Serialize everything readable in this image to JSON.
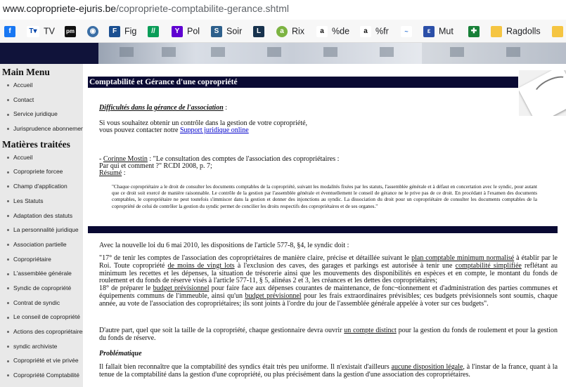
{
  "browser": {
    "url_domain": "www.copropriete-ejuris.be",
    "url_path": "/copropriete-comptabilite-gerance.shtml",
    "bookmarks": [
      {
        "label": "",
        "icon": "facebook-icon"
      },
      {
        "label": "TV",
        "icon": "tv-icon"
      },
      {
        "label": "",
        "icon": "pm-icon"
      },
      {
        "label": "",
        "icon": "globe-icon"
      },
      {
        "label": "Fig",
        "icon": "figaro-icon"
      },
      {
        "label": "",
        "icon": "bookmark-green-icon"
      },
      {
        "label": "Pol",
        "icon": "yahoo-icon"
      },
      {
        "label": "Soir",
        "icon": "soir-icon"
      },
      {
        "label": "",
        "icon": "l-icon"
      },
      {
        "label": "Rix",
        "icon": "rix-icon"
      },
      {
        "label": "%de",
        "icon": "amazon-icon"
      },
      {
        "label": "%fr",
        "icon": "amazon-icon"
      },
      {
        "label": "",
        "icon": "link-icon"
      },
      {
        "label": "Mut",
        "icon": "mut-icon"
      },
      {
        "label": "",
        "icon": "green-square-icon"
      },
      {
        "label": "Ragdolls",
        "icon": "folder-icon"
      },
      {
        "label": "",
        "icon": "folder-icon"
      }
    ]
  },
  "sidebar": {
    "main_menu_title": "Main Menu",
    "main_menu": [
      "Accueil",
      "Contact",
      "Service juridique",
      "Jurisprudence abonnement"
    ],
    "topics_title": "Matières traitées",
    "topics": [
      "Accueil",
      "Copropriete forcee",
      "Champ d'application",
      "Les Statuts",
      "Adaptation des statuts",
      "La personnalité juridique",
      "Association partielle",
      "Copropriétaire",
      "L'assemblée générale",
      "Syndic de copropriété",
      "Contrat de syndic",
      "Le conseil de copropriété",
      "Actions des copropriétaires",
      "syndic archiviste",
      "Copropriété et vie privée",
      "Copropriété Comptabilité"
    ]
  },
  "content": {
    "title": "Comptabilité et Gérance d'une copropriété",
    "section1_heading": "Difficultés dans la gérance de l'association",
    "section1_colon": " :",
    "section1_line1": "Si vous souhaitez obtenir un contrôle dans la gestion de votre copropriété,",
    "section1_line2": "vous pouvez contacter notre ",
    "section1_link": "Support juridique online",
    "ref_dash": "- ",
    "ref_author": "Corinne Mostin",
    "ref_title": " : \"Le consultation des comptes de l'association des copropriétaires :",
    "ref_line2": "Par qui et comment ?\" RCDI 2008, p. 7;",
    "ref_resume": "Résumé",
    "ref_resume_colon": " :",
    "quote": "\"Chaque copropriétaire a le droit de consulter les documents comptables de la copropriété, suivant les modalités fixées par les statuts, l'assemblée générale et à défaut en concertation avec le syndic, pour autant que ce droit soit exercé de manière raisonnable. Le contrôle de la gestion par l'assemblée générale et éventuellement le conseil de gérance ne le prive pas de ce droit. En procédant à l'examen des documents comptables, le copropriétaire ne peut toutefois s'immiscer dans la gestion et donner des injonctions au syndic. La dissociation du droit pour un copropriétaire de consulter les documents comptables de la copropriété de celui de contrôler la gestion du syndic permet de concilier les droits respectifs des copropriétaires et de ses organes.\"",
    "law_intro": "Avec la nouvelle loi du 6 mai 2010, les dispositions de l'article 577-8, §4, le syndic doit :",
    "art17_a": "\"17° de tenir les comptes de l'association des copropriétaires de manière claire, précise et détaillée suivant le ",
    "art17_link1": "plan comptable minimum normalisé",
    "art17_b": " à établir par le Roi. Toute copropriété ",
    "art17_link2": "de moins de vingt lots",
    "art17_c": " à l'exclusion des caves, des garages et parkings est autorisée à tenir une ",
    "art17_link3": "comptabilité simplifiée",
    "art17_d": " reflétant au minimum les recettes et les dépenses, la situation de trésorerie ainsi que les mouvements des disponibilités en espèces et en compte, le montant du fonds de roulement et du fonds de réserve visés à l'article 577-11, § 5, alinéas 2 et 3, les créances et les dettes des copropriétaires;",
    "art18_a": "18° de préparer le ",
    "art18_link1": "budget prévisionnel",
    "art18_b": " pour faire face aux dépenses courantes de maintenance, de fonc¬tionnement et d'administration des parties communes et équipements communs de l'immeuble, ainsi qu'un ",
    "art18_link2": "budget prévisionnel",
    "art18_c": " pour les frais extraordinaires prévisibles; ces budgets prévisionnels sont soumis, chaque année, au vote de l'association des copropriétaires; ils sont joints à l'ordre du jour de l'assemblée générale appelée à voter sur ces budgets\".",
    "para2_a": "D'autre part, quel que soit la taille de la copropriété, chaque gestionnaire devra ouvrir ",
    "para2_link": "un compte distinct",
    "para2_b": " pour la gestion du fonds de roulement et pour la gestion du fonds de réserve.",
    "problem_heading": "Problématique",
    "para3_a": "Il fallait bien reconnaître que la comptabilité des syndics était très peu uniforme. Il n'existait d'ailleurs ",
    "para3_link": "aucune disposition légale",
    "para3_b": ", à l'instar de la france, quant à la tenue de la comptabilité dans la gestion d'une copropriété, ou plus précisément dans la gestion d'une association des copropriétaires."
  },
  "colors": {
    "banner": "#10133a",
    "title_bar": "#0a0a33",
    "sidebar": "#e9e9e9",
    "link": "#0000cc"
  }
}
